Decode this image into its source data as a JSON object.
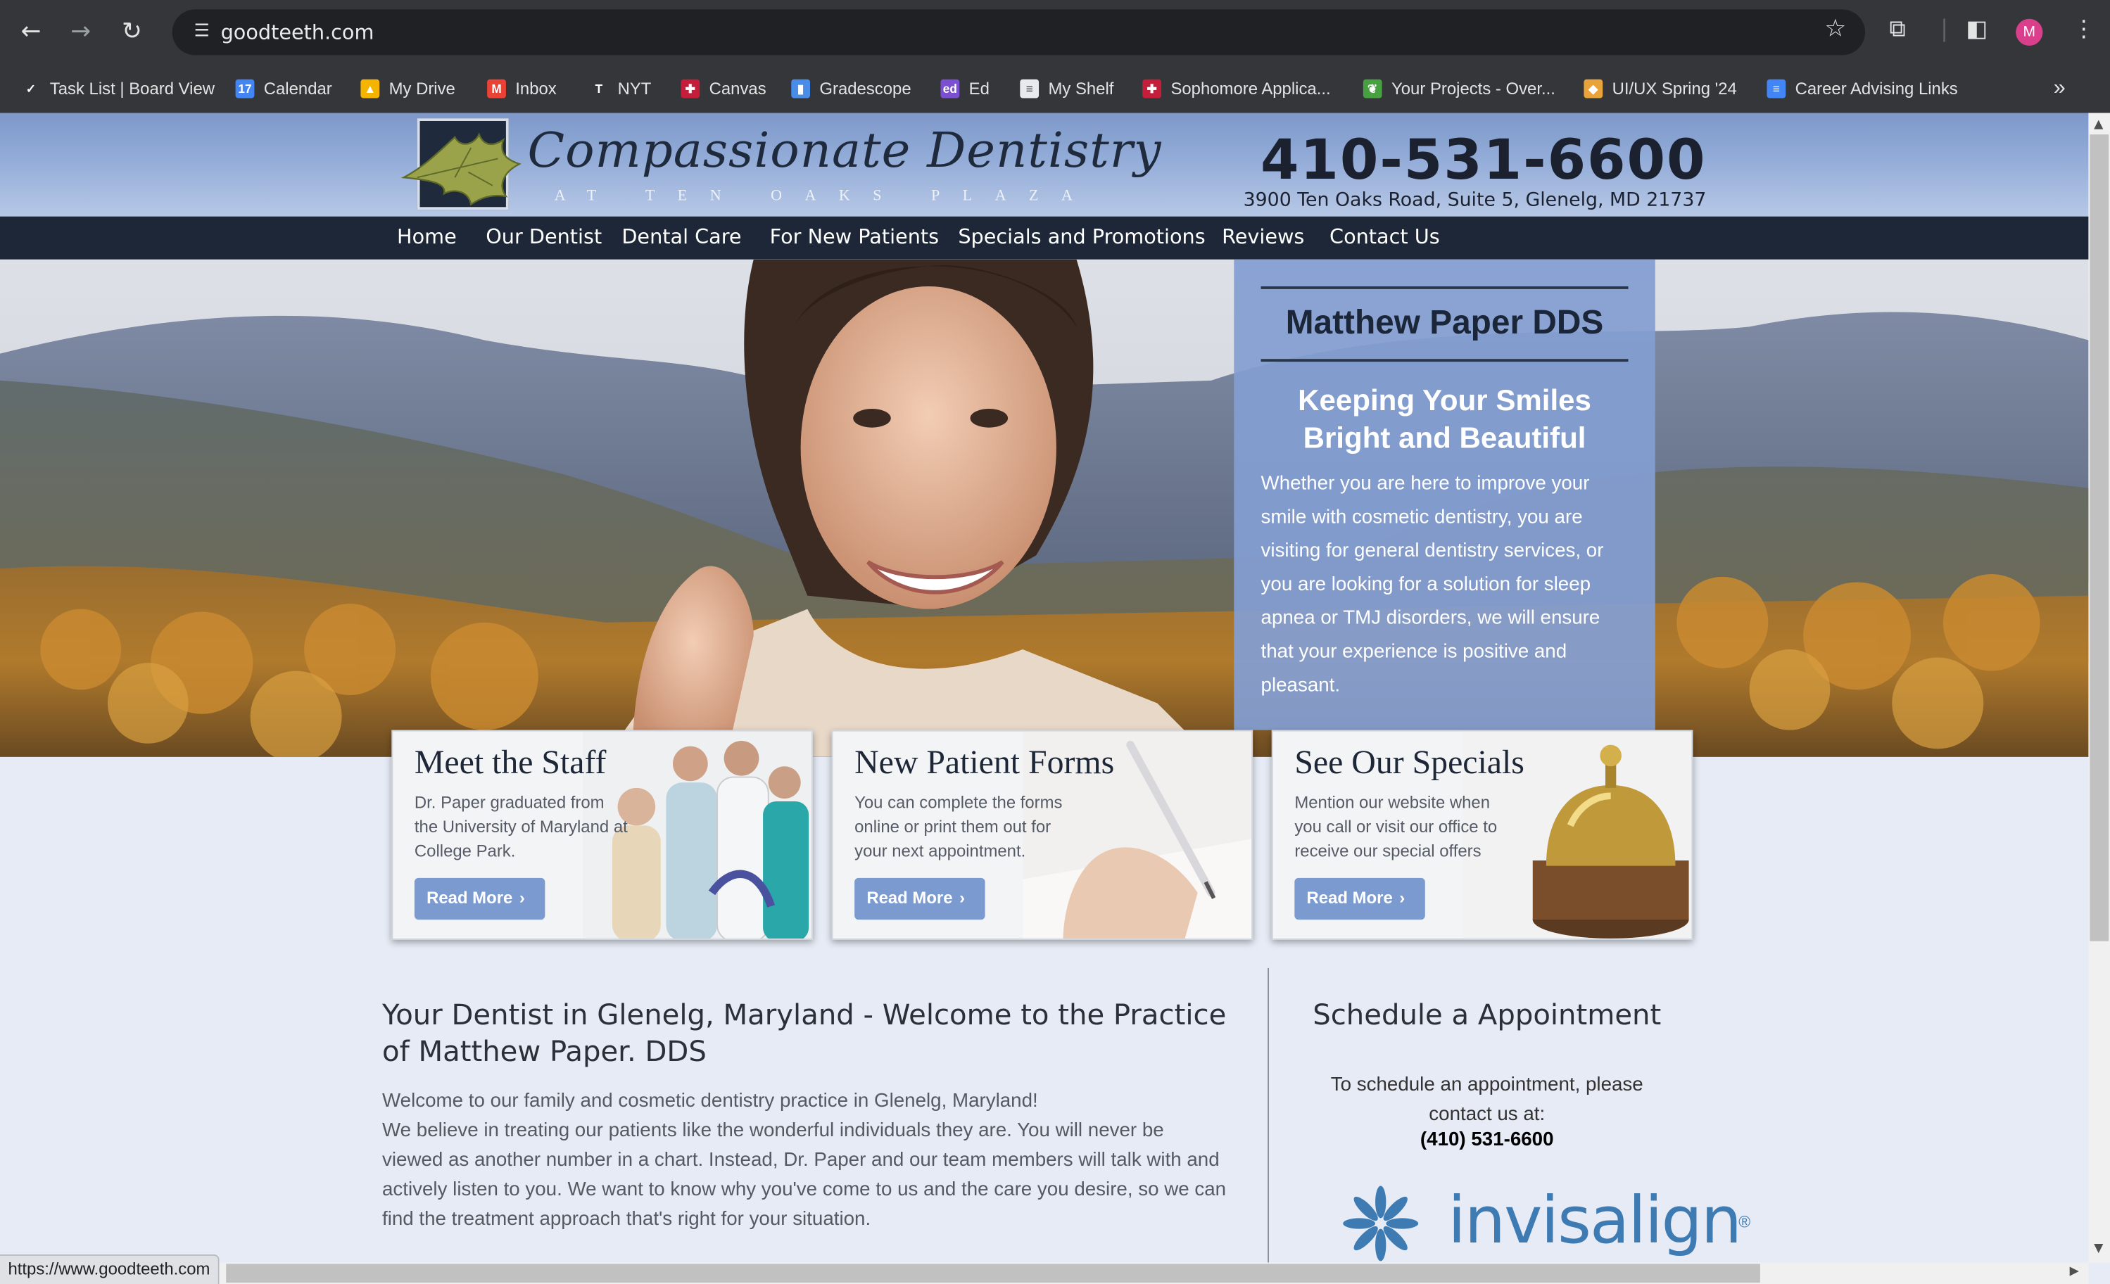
{
  "browser": {
    "url": "goodteeth.com",
    "avatar_initial": "M",
    "status_url": "https://www.goodteeth.com",
    "bookmarks": [
      {
        "label": "Task List | Board View",
        "icon": "checklist-icon",
        "color": "#35363a"
      },
      {
        "label": "Calendar",
        "icon": "calendar-icon",
        "color": "#4285f4"
      },
      {
        "label": "My Drive",
        "icon": "drive-icon",
        "color": "#f4b400"
      },
      {
        "label": "Inbox",
        "icon": "gmail-icon",
        "color": "#ea4335"
      },
      {
        "label": "NYT",
        "icon": "nyt-icon",
        "color": "#35363a"
      },
      {
        "label": "Canvas",
        "icon": "shield-icon",
        "color": "#c41e3a"
      },
      {
        "label": "Gradescope",
        "icon": "bar-chart-icon",
        "color": "#4a8de8"
      },
      {
        "label": "Ed",
        "icon": "ed-icon",
        "color": "#7b4fd1"
      },
      {
        "label": "My Shelf",
        "icon": "document-icon",
        "color": "#e8eaed"
      },
      {
        "label": "Sophomore Applica...",
        "icon": "shield-icon",
        "color": "#c41e3a"
      },
      {
        "label": "Your Projects - Over...",
        "icon": "overleaf-icon",
        "color": "#47a141"
      },
      {
        "label": "UI/UX Spring '24",
        "icon": "figma-icon",
        "color": "#e8a33a"
      },
      {
        "label": "Career Advising Links",
        "icon": "docs-icon",
        "color": "#4285f4"
      }
    ]
  },
  "header": {
    "logo_main": "Compassionate Dentistry",
    "logo_sub": "AT TEN OAKS PLAZA",
    "phone": "410-531-6600",
    "address": "3900 Ten Oaks Road, Suite 5, Glenelg, MD 21737"
  },
  "nav": [
    "Home",
    "Our Dentist",
    "Dental Care",
    "For New Patients",
    "Specials and Promotions",
    "Reviews",
    "Contact Us"
  ],
  "hero": {
    "doctor": "Matthew Paper DDS",
    "tagline": "Keeping Your Smiles Bright and Beautiful",
    "body": "Whether you are here to improve your smile with cosmetic dentistry, you are visiting for general dentistry services, or you are looking for a solution for sleep apnea or TMJ disorders, we will ensure that your experience is positive and pleasant."
  },
  "cards": [
    {
      "title": "Meet the Staff",
      "text": "Dr. Paper graduated from the University of Maryland at College Park.",
      "button": "Read More"
    },
    {
      "title": "New Patient Forms",
      "text": "You can complete the forms online or print them out for your next appointment.",
      "button": "Read More"
    },
    {
      "title": "See Our Specials",
      "text": "Mention our website when you call or visit our office to receive our special offers",
      "button": "Read More"
    }
  ],
  "intro": {
    "title": "Your Dentist in Glenelg, Maryland - Welcome to the Practice of Matthew Paper. DDS",
    "p1": "Welcome to our family and cosmetic dentistry practice in Glenelg, Maryland!",
    "p2": "We believe in treating our patients like the wonderful individuals they are. You will never be viewed as another number in a chart. Instead, Dr. Paper and our team members will talk with and actively listen to you. We want to know why you've come to us and the care you desire, so we can find the treatment approach that's right for your situation."
  },
  "schedule": {
    "title": "Schedule a Appointment",
    "text": "To schedule an appointment, please contact us at:",
    "phone": "(410) 531-6600"
  },
  "invisalign": {
    "word": "invisalign",
    "reg": "®"
  }
}
